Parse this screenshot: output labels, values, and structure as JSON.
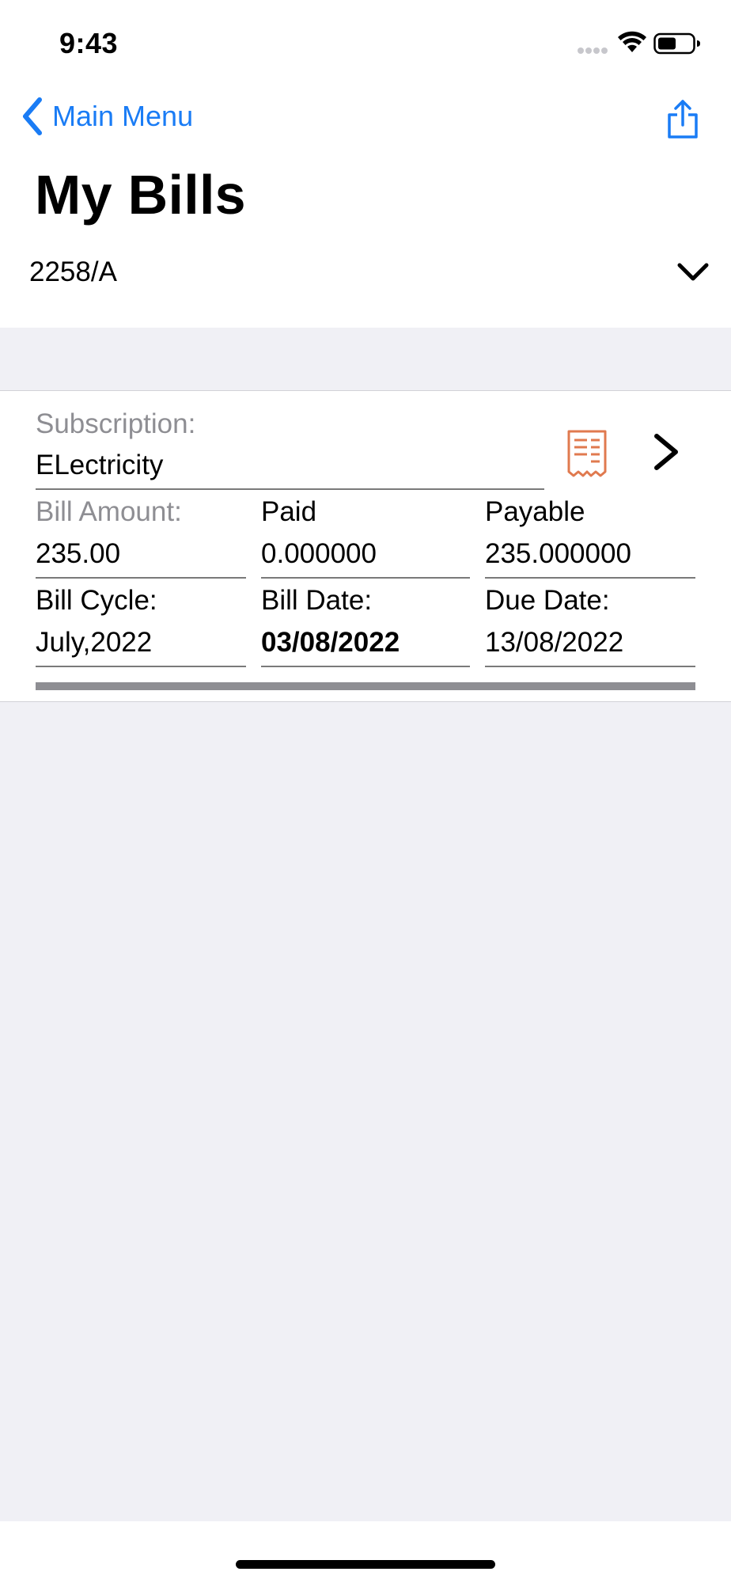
{
  "status_bar": {
    "time": "9:43",
    "icons": [
      "cellular-dots-icon",
      "wifi-icon",
      "battery-icon"
    ]
  },
  "nav": {
    "back_label": "Main Menu",
    "back_icon": "chevron-left-icon",
    "share_icon": "share-icon"
  },
  "page": {
    "title": "My Bills",
    "account": "2258/A",
    "account_toggle_icon": "chevron-down-icon"
  },
  "bill": {
    "subscription_label": "Subscription:",
    "subscription_value": "ELectricity",
    "receipt_icon": "receipt-icon",
    "detail_icon": "chevron-right-icon",
    "bill_amount_label": "Bill Amount:",
    "bill_amount_value": "235.00",
    "paid_label": "Paid",
    "paid_value": "0.000000",
    "payable_label": "Payable",
    "payable_value": "235.000000",
    "bill_cycle_label": "Bill Cycle:",
    "bill_cycle_value": "July,2022",
    "bill_date_label": "Bill Date:",
    "bill_date_value": "03/08/2022",
    "due_date_label": "Due Date:",
    "due_date_value": "13/08/2022"
  },
  "colors": {
    "accent": "#1a7cf5",
    "receipt": "#e07a4f",
    "grouped_background": "#f0f0f5",
    "secondary_text": "#8e8e93"
  }
}
